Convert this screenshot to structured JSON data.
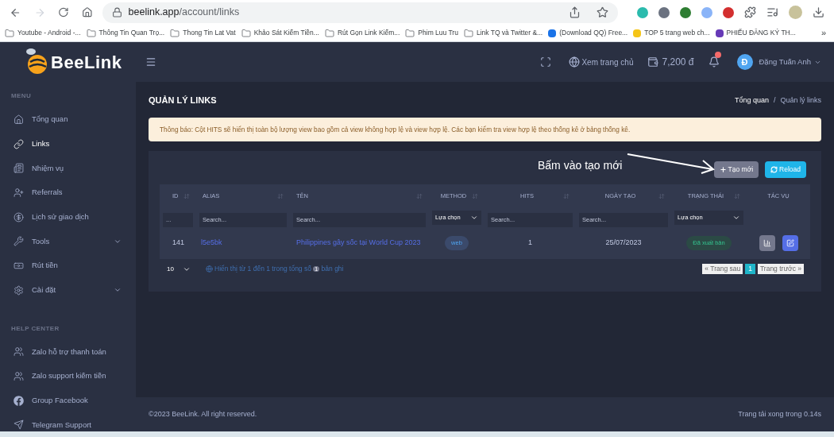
{
  "browser": {
    "url_host": "beelink.app",
    "url_path": "/account/links",
    "bookmarks": [
      {
        "kind": "folder",
        "label": "Youtube - Android -..."
      },
      {
        "kind": "folder",
        "label": "Thông Tin Quan Trọ..."
      },
      {
        "kind": "folder",
        "label": "Thong Tin Lat Vat"
      },
      {
        "kind": "folder",
        "label": "Khảo Sát Kiếm Tiền..."
      },
      {
        "kind": "folder",
        "label": "Rút Gọn Link Kiếm..."
      },
      {
        "kind": "folder",
        "label": "Phim Luu Tru"
      },
      {
        "kind": "folder",
        "label": "Link TQ và Twitter &..."
      },
      {
        "kind": "site",
        "label": "(Download QQ) Free..."
      },
      {
        "kind": "site",
        "label": "TOP 5 trang web ch..."
      },
      {
        "kind": "site",
        "label": "PHIẾU ĐĂNG KÝ TH..."
      }
    ],
    "overflow": "»"
  },
  "sidebar": {
    "logo": "BeeLink",
    "sections": [
      {
        "title": "MENU",
        "items": [
          {
            "label": "Tổng quan",
            "selected": false,
            "expandable": false
          },
          {
            "label": "Links",
            "selected": true,
            "expandable": false
          },
          {
            "label": "Nhiệm vụ",
            "selected": false,
            "expandable": false
          },
          {
            "label": "Referrals",
            "selected": false,
            "expandable": false
          },
          {
            "label": "Lịch sử giao dịch",
            "selected": false,
            "expandable": false
          },
          {
            "label": "Tools",
            "selected": false,
            "expandable": true
          },
          {
            "label": "Rút tiền",
            "selected": false,
            "expandable": false
          },
          {
            "label": "Cài đặt",
            "selected": false,
            "expandable": true
          }
        ]
      },
      {
        "title": "HELP CENTER",
        "items": [
          {
            "label": "Zalo hỗ trợ thanh toán",
            "selected": false,
            "expandable": false
          },
          {
            "label": "Zalo support kiếm tiền",
            "selected": false,
            "expandable": false
          },
          {
            "label": "Group Facebook",
            "selected": false,
            "expandable": false
          },
          {
            "label": "Telegram Support",
            "selected": false,
            "expandable": false
          }
        ]
      }
    ]
  },
  "header": {
    "home_link": "Xem trang chủ",
    "balance": "7,200 đ",
    "unread": true,
    "avatar_letter": "Đ",
    "user_name": "Đặng Tuấn Anh"
  },
  "page": {
    "title": "QUẢN LÝ LINKS",
    "breadcrumb": [
      {
        "label": "Tổng quan",
        "selected": false
      },
      {
        "label": "Quản lý links",
        "selected": true
      }
    ],
    "breadcrumb_separator": "/",
    "notice": "Thông báo: Cột HITS sẽ hiển thị toàn bộ lượng view bao gồm cả view không hợp lệ và view hợp lệ. Các bạn kiểm tra view hợp lệ theo thống kê ở bảng thống kê.",
    "annotation": "Bấm vào tạo mới",
    "buttons": [
      {
        "kind": "create",
        "label": "Tạo mới"
      },
      {
        "kind": "reload",
        "label": "Reload"
      }
    ]
  },
  "table": {
    "columns": [
      {
        "label": "ID",
        "sortable": true
      },
      {
        "label": "ALIAS",
        "sortable": true
      },
      {
        "label": "TÊN",
        "sortable": true
      },
      {
        "label": "METHOD",
        "sortable": true
      },
      {
        "label": "HITS",
        "sortable": true
      },
      {
        "label": "NGÀY TẠO",
        "sortable": true
      },
      {
        "label": "TRẠNG THÁI",
        "sortable": true
      },
      {
        "label": "TÁC VỤ",
        "sortable": false
      }
    ],
    "filters": [
      {
        "kind": "input",
        "placeholder": "..."
      },
      {
        "kind": "input",
        "placeholder": "Search..."
      },
      {
        "kind": "input",
        "placeholder": "Search..."
      },
      {
        "kind": "select",
        "value": "Lựa chọn"
      },
      {
        "kind": "input",
        "placeholder": "Search..."
      },
      {
        "kind": "input",
        "placeholder": "Search..."
      },
      {
        "kind": "select",
        "value": "Lựa chọn"
      }
    ],
    "rows": [
      {
        "id": "141",
        "alias": "l5e5bk",
        "name": "Philippines gây sốc tại World Cup 2023",
        "method": "web",
        "hits": "1",
        "date": "25/07/2023",
        "status": "Đã xuất bản",
        "actions": [
          {
            "kind": "stats"
          },
          {
            "kind": "edit"
          }
        ]
      }
    ],
    "page_size": "10",
    "info_before": "Hiển thị từ 1 đến 1 trong tổng số",
    "info_count": "1",
    "info_after": "bản ghi",
    "pagination": [
      {
        "label": "« Trang sau",
        "selected": false
      },
      {
        "label": "1",
        "selected": true
      },
      {
        "label": "Trang trước »",
        "selected": false
      }
    ]
  },
  "footer": {
    "copyright": "©2023 BeeLink. All right reserved.",
    "load_time": "Trang tải xong trong 0.14s"
  }
}
